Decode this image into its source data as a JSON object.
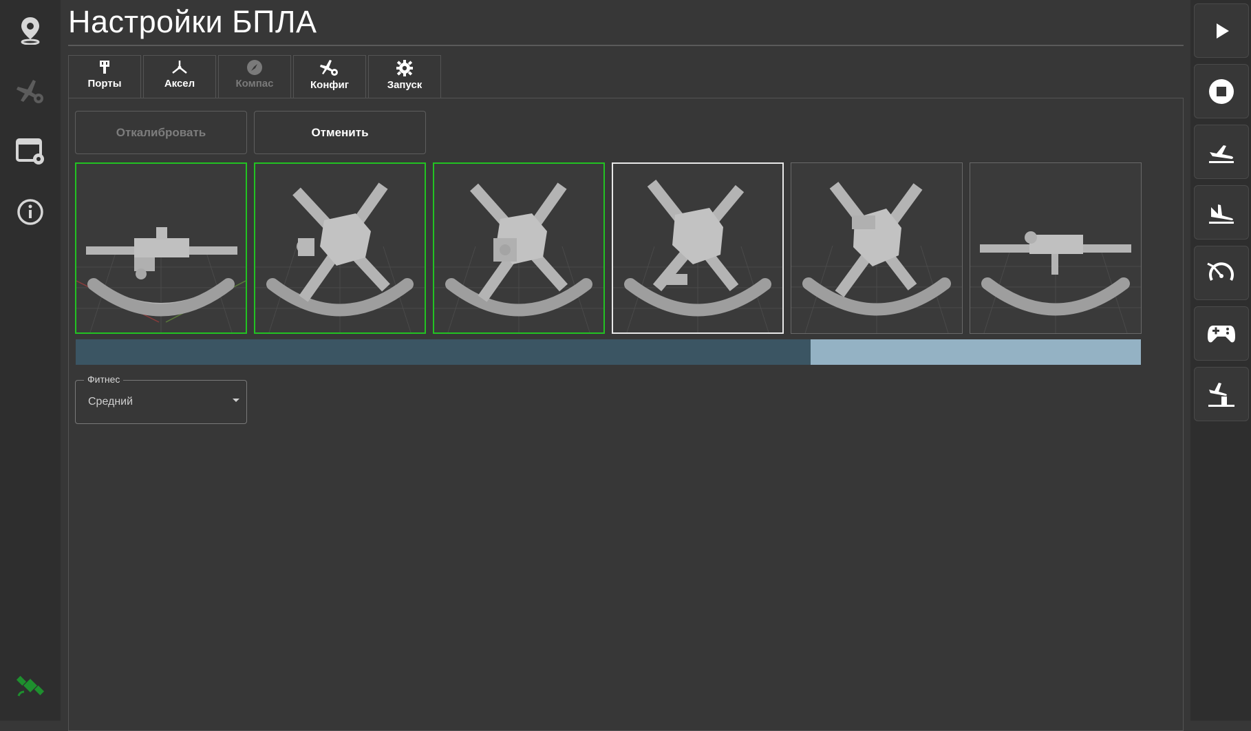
{
  "page": {
    "title": "Настройки БПЛА"
  },
  "left_sidebar": {
    "items": [
      {
        "icon": "map-pin-icon"
      },
      {
        "icon": "aircraft-settings-icon"
      },
      {
        "icon": "window-settings-icon"
      },
      {
        "icon": "info-icon"
      }
    ],
    "status_icon": "satellite-icon",
    "status_color": "#1e8f2e"
  },
  "tabs": [
    {
      "label": "Порты",
      "icon": "ports-icon",
      "enabled": true
    },
    {
      "label": "Аксел",
      "icon": "axes-icon",
      "enabled": true
    },
    {
      "label": "Компас",
      "icon": "compass-icon",
      "enabled": false
    },
    {
      "label": "Конфиг",
      "icon": "aircraft-gear-icon",
      "enabled": true
    },
    {
      "label": "Запуск",
      "icon": "gear-icon",
      "enabled": true
    }
  ],
  "actions": {
    "calibrate_label": "Откалибровать",
    "cancel_label": "Отменить"
  },
  "calibration": {
    "orientations": [
      {
        "view": "level",
        "status": "done"
      },
      {
        "view": "nose-down",
        "status": "done"
      },
      {
        "view": "nose-down-rotated",
        "status": "done"
      },
      {
        "view": "nose-up",
        "status": "active"
      },
      {
        "view": "nose-up-rotated",
        "status": "pending"
      },
      {
        "view": "upside-down",
        "status": "pending"
      }
    ],
    "progress_fraction": 0.69,
    "colors": {
      "done": "#22c322",
      "active": "#e8e8e8",
      "pending": "#6a6a6a",
      "progress_fill": "#3b5563",
      "progress_track": "#94b2c4"
    }
  },
  "fitness": {
    "label": "Фитнес",
    "value": "Средний"
  },
  "right_toolbar": {
    "items": [
      {
        "icon": "play-icon"
      },
      {
        "icon": "stop-icon"
      },
      {
        "icon": "takeoff-icon"
      },
      {
        "icon": "landing-icon"
      },
      {
        "icon": "speedometer-icon"
      },
      {
        "icon": "gamepad-icon"
      },
      {
        "icon": "takeoff-tower-icon"
      }
    ]
  }
}
